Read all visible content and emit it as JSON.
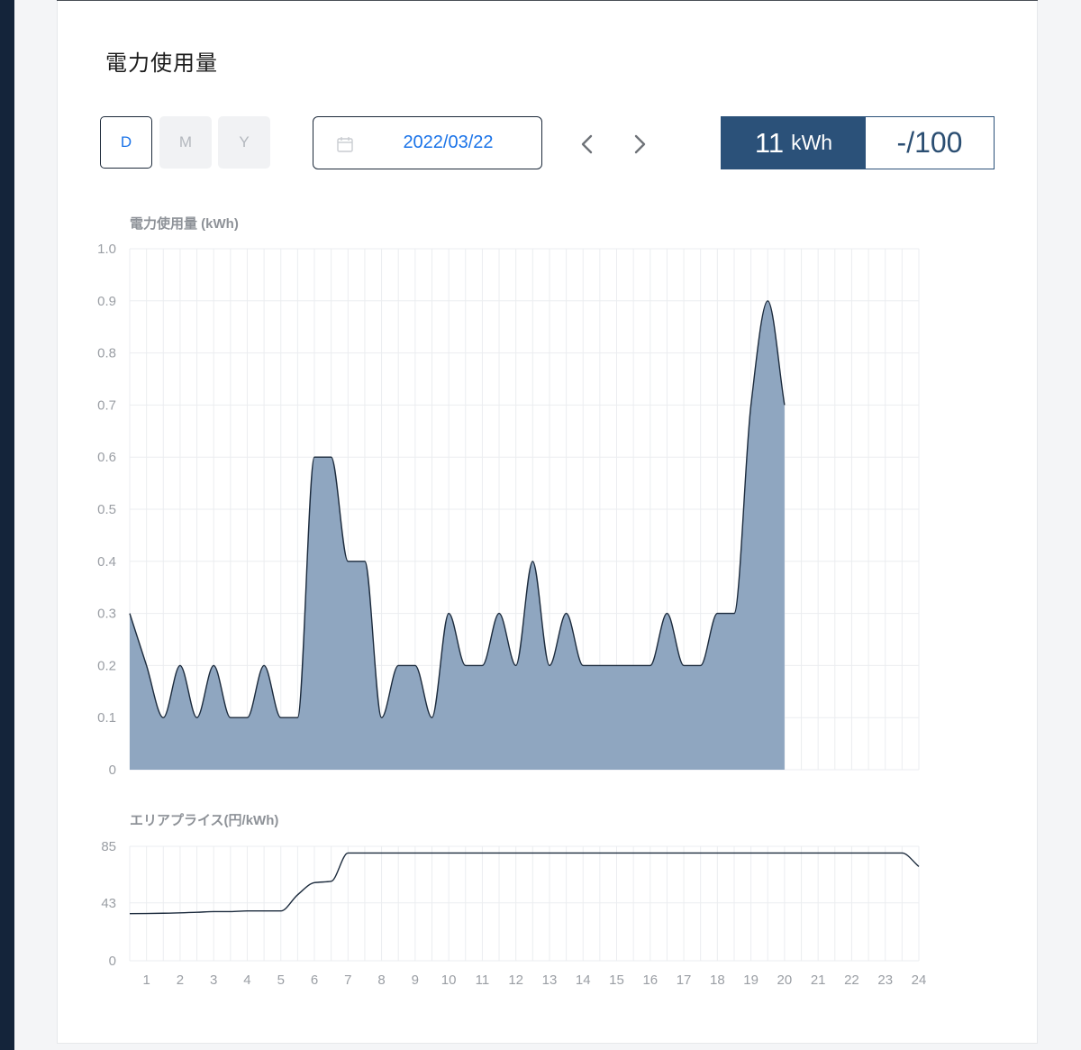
{
  "title": "電力使用量",
  "period_buttons": [
    {
      "label": "D",
      "active": true
    },
    {
      "label": "M",
      "active": false
    },
    {
      "label": "Y",
      "active": false
    }
  ],
  "date_picker": {
    "value": "2022/03/22",
    "icon": "calendar-icon"
  },
  "nav": {
    "prev_icon": "chevron-left-icon",
    "next_icon": "chevron-right-icon"
  },
  "usage_summary": {
    "value": "11",
    "unit": "kWh",
    "target": "-/100"
  },
  "colors": {
    "accent": "#2b5179",
    "link_blue": "#1a73e8",
    "area_fill": "#8fa6c0",
    "line": "#1c2b3d"
  },
  "chart_data": [
    {
      "type": "area",
      "ylabel": "電力使用量 (kWh)",
      "ylim": [
        0,
        1.0
      ],
      "y_ticks": [
        "0",
        "0.1",
        "0.2",
        "0.3",
        "0.4",
        "0.5",
        "0.6",
        "0.7",
        "0.8",
        "0.9",
        "1.0"
      ],
      "x_range": [
        0.5,
        24
      ],
      "grid": true,
      "series": [
        {
          "x": [
            0.5,
            1.0,
            1.5,
            2.0,
            2.5,
            3.0,
            3.5,
            4.0,
            4.5,
            5.0,
            5.5,
            6.0,
            6.5,
            7.0,
            7.5,
            8.0,
            8.5,
            9.0,
            9.5,
            10.0,
            10.5,
            11.0,
            11.5,
            12.0,
            12.5,
            13.0,
            13.5,
            14.0,
            14.5,
            15.0,
            15.5,
            16.0,
            16.5,
            17.0,
            17.5,
            18.0,
            18.5,
            19.0,
            19.5,
            20.0
          ],
          "values": [
            0.3,
            0.2,
            0.1,
            0.2,
            0.1,
            0.2,
            0.1,
            0.1,
            0.2,
            0.1,
            0.1,
            0.6,
            0.6,
            0.4,
            0.4,
            0.1,
            0.2,
            0.2,
            0.1,
            0.3,
            0.2,
            0.2,
            0.3,
            0.2,
            0.4,
            0.2,
            0.3,
            0.2,
            0.2,
            0.2,
            0.2,
            0.2,
            0.3,
            0.2,
            0.2,
            0.3,
            0.3,
            0.7,
            0.9,
            0.7
          ]
        }
      ]
    },
    {
      "type": "line",
      "ylabel": "エリアプライス(円/kWh)",
      "ylim": [
        0,
        85
      ],
      "y_ticks": [
        "0",
        "43",
        "85"
      ],
      "x_ticks": [
        "1",
        "2",
        "3",
        "4",
        "5",
        "6",
        "7",
        "8",
        "9",
        "10",
        "11",
        "12",
        "13",
        "14",
        "15",
        "16",
        "17",
        "18",
        "19",
        "20",
        "21",
        "22",
        "23",
        "24"
      ],
      "x_range": [
        0.5,
        24
      ],
      "grid": true,
      "series": [
        {
          "x": [
            0.5,
            1.5,
            2.5,
            3.0,
            3.5,
            4.0,
            4.5,
            5.0,
            5.5,
            6.0,
            6.5,
            7.0,
            7.5,
            8.0,
            10.0,
            12.0,
            14.0,
            16.0,
            18.0,
            20.0,
            22.0,
            23.5,
            24.0
          ],
          "values": [
            35,
            35.3,
            36,
            36.5,
            36.5,
            37,
            37,
            37,
            49,
            58,
            59,
            80,
            80,
            80,
            80,
            80,
            80,
            80,
            80,
            80,
            80,
            80,
            70
          ]
        }
      ]
    }
  ]
}
